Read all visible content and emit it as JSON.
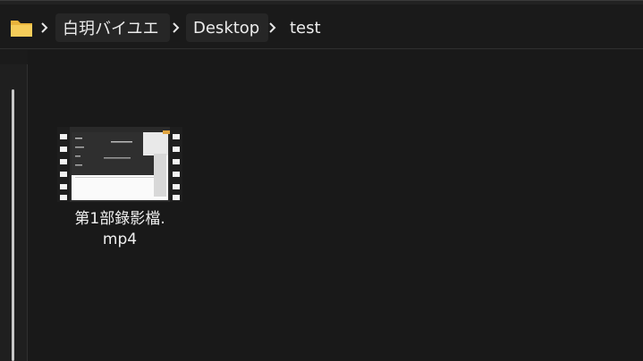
{
  "breadcrumb": {
    "items": [
      {
        "label": "白玥バイユエ"
      },
      {
        "label": "Desktop"
      },
      {
        "label": "test"
      }
    ]
  },
  "icons": {
    "folder": "folder-icon",
    "separator": "chevron-right-icon",
    "video": "video-file-icon"
  },
  "colors": {
    "folder": "#f2c14e",
    "background": "#191919"
  },
  "files": [
    {
      "name_line1": "第1部錄影檔.",
      "name_line2": "mp4"
    }
  ]
}
